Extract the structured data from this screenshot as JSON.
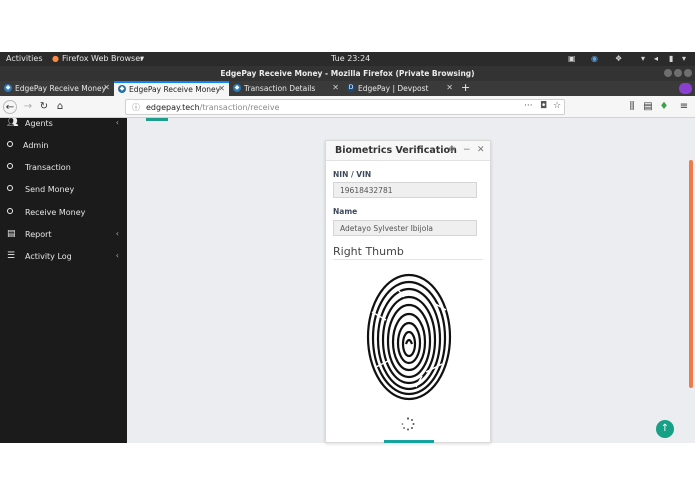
{
  "system_bar": {
    "activities": "Activities",
    "app_menu": "Firefox Web Browser",
    "app_menu_arrow": "▾",
    "clock": "Tue 23:24"
  },
  "window": {
    "title": "EdgePay Receive Money - Mozilla Firefox (Private Browsing)"
  },
  "tabs": [
    {
      "label": "EdgePay Receive Money",
      "active": false,
      "icon": "edgepay-favicon"
    },
    {
      "label": "EdgePay Receive Money",
      "active": true,
      "icon": "edgepay-favicon"
    },
    {
      "label": "Transaction Details",
      "active": false,
      "icon": "edgepay-favicon"
    },
    {
      "label": "EdgePay | Devpost",
      "active": false,
      "icon": "devpost-favicon"
    }
  ],
  "new_tab_symbol": "+",
  "address_bar": {
    "domain": "edgepay.tech",
    "path": "/transaction/receive"
  },
  "sidebar": {
    "items": [
      {
        "label": "Agents",
        "icon": "users-icon",
        "chevron": "‹"
      },
      {
        "label": "Admin",
        "icon": "user-circle-icon",
        "chevron": ""
      },
      {
        "label": "Transaction",
        "icon": "circle-icon",
        "chevron": ""
      },
      {
        "label": "Send Money",
        "icon": "circle-icon",
        "chevron": ""
      },
      {
        "label": "Receive Money",
        "icon": "circle-icon",
        "chevron": ""
      },
      {
        "label": "Report",
        "icon": "document-icon",
        "chevron": "‹"
      },
      {
        "label": "Activity Log",
        "icon": "list-icon",
        "chevron": "‹"
      }
    ]
  },
  "modal": {
    "title": "Biometrics Verification",
    "nin_label": "NIN / VIN",
    "nin_value": "19618432781",
    "name_label": "Name",
    "name_value": "Adetayo Sylvester Ibijola",
    "thumb_heading": "Right Thumb",
    "status": "loading"
  },
  "colors": {
    "accent": "#16a085",
    "scrollbar": "#f07b48",
    "sidebar_bg": "#1b1b1b",
    "content_bg": "#ecedf0"
  }
}
